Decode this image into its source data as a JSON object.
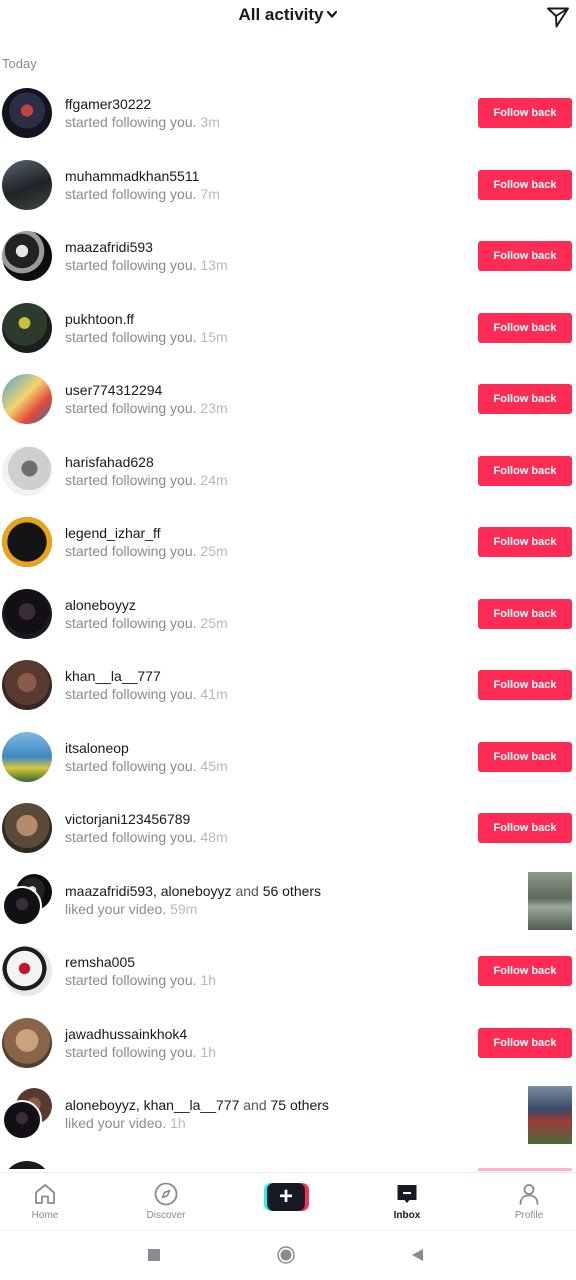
{
  "header": {
    "title": "All activity",
    "dropdown_icon": "chevron-down-icon",
    "filter_icon": "paper-plane-icon"
  },
  "section": {
    "label": "Today"
  },
  "activities": [
    {
      "type": "follow",
      "username": "ffgamer30222",
      "action": "started following you.",
      "time": "3m",
      "button": "Follow back"
    },
    {
      "type": "follow",
      "username": "muhammadkhan5511",
      "action": "started following you.",
      "time": "7m",
      "button": "Follow back"
    },
    {
      "type": "follow",
      "username": "maazafridi593",
      "action": "started following you.",
      "time": "13m",
      "button": "Follow back"
    },
    {
      "type": "follow",
      "username": "pukhtoon.ff",
      "action": "started following you.",
      "time": "15m",
      "button": "Follow back"
    },
    {
      "type": "follow",
      "username": "user774312294",
      "action": "started following you.",
      "time": "23m",
      "button": "Follow back"
    },
    {
      "type": "follow",
      "username": "harisfahad628",
      "action": "started following you.",
      "time": "24m",
      "button": "Follow back"
    },
    {
      "type": "follow",
      "username": "legend_izhar_ff",
      "action": "started following you.",
      "time": "25m",
      "button": "Follow back"
    },
    {
      "type": "follow",
      "username": "aloneboyyz",
      "action": "started following you.",
      "time": "25m",
      "button": "Follow back"
    },
    {
      "type": "follow",
      "username": "khan__la__777",
      "action": "started following you.",
      "time": "41m",
      "button": "Follow back"
    },
    {
      "type": "follow",
      "username": "itsaloneop",
      "action": "started following you.",
      "time": "45m",
      "button": "Follow back"
    },
    {
      "type": "follow",
      "username": "victorjani123456789",
      "action": "started following you.",
      "time": "48m",
      "button": "Follow back"
    },
    {
      "type": "like",
      "users": "maazafridi593, aloneboyyz",
      "and_word": "and",
      "others": "56 others",
      "action": "liked your video.",
      "time": "59m"
    },
    {
      "type": "follow",
      "username": "remsha005",
      "action": "started following you.",
      "time": "1h",
      "button": "Follow back"
    },
    {
      "type": "follow",
      "username": "jawadhussainkhok4",
      "action": "started following you.",
      "time": "1h",
      "button": "Follow back"
    },
    {
      "type": "like",
      "users": "aloneboyyz, khan__la__777",
      "and_word": "and",
      "others": "75 others",
      "action": "liked your video.",
      "time": "1h"
    }
  ],
  "tabbar": {
    "home": "Home",
    "discover": "Discover",
    "create": "+",
    "inbox": "Inbox",
    "profile": "Profile"
  },
  "colors": {
    "accent": "#fe2c55",
    "text_primary": "#161823",
    "text_secondary": "#8a8b91",
    "create_cyan": "#25f4ee"
  }
}
